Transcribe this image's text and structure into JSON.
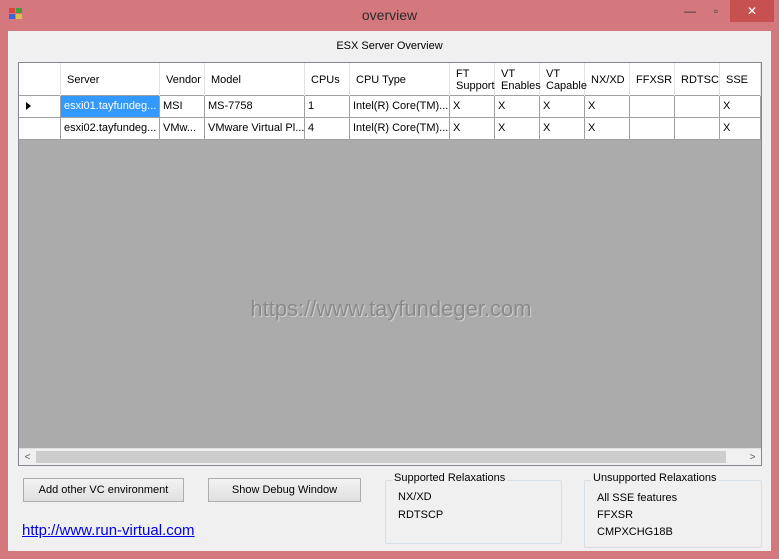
{
  "window": {
    "title": "overview",
    "controls": {
      "minimize": "—",
      "maximize": "▫",
      "close": "✕"
    }
  },
  "heading": "ESX Server Overview",
  "grid": {
    "columns": [
      {
        "key": "server",
        "label": "Server"
      },
      {
        "key": "vendor",
        "label": "Vendor"
      },
      {
        "key": "model",
        "label": "Model"
      },
      {
        "key": "cpus",
        "label": "CPUs"
      },
      {
        "key": "cputype",
        "label": "CPU Type"
      },
      {
        "key": "ft",
        "label": "FT Support"
      },
      {
        "key": "vten",
        "label": "VT Enables"
      },
      {
        "key": "vtcap",
        "label": "VT Capable"
      },
      {
        "key": "nx",
        "label": "NX/XD"
      },
      {
        "key": "ffxsr",
        "label": "FFXSR"
      },
      {
        "key": "rdtsc",
        "label": "RDTSC"
      },
      {
        "key": "sse",
        "label": "SSE"
      }
    ],
    "rows": [
      {
        "server": "esxi01.tayfundeg...",
        "vendor": "MSI",
        "model": "MS-7758",
        "cpus": "1",
        "cputype": "Intel(R) Core(TM)...",
        "ft": "X",
        "vten": "X",
        "vtcap": "X",
        "nx": "X",
        "ffxsr": "",
        "rdtsc": "",
        "sse": "X"
      },
      {
        "server": "esxi02.tayfundeg...",
        "vendor": "VMw...",
        "model": "VMware Virtual Pl...",
        "cpus": "4",
        "cputype": "Intel(R) Core(TM)...",
        "ft": "X",
        "vten": "X",
        "vtcap": "X",
        "nx": "X",
        "ffxsr": "",
        "rdtsc": "",
        "sse": "X"
      }
    ],
    "watermark": "https://www.tayfundeger.com",
    "scroll": {
      "left_arrow": "<",
      "right_arrow": ">"
    }
  },
  "buttons": {
    "add_vc": "Add other VC environment",
    "debug": "Show Debug Window"
  },
  "link": "http://www.run-virtual.com",
  "supported": {
    "title": "Supported Relaxations",
    "items": [
      "NX/XD",
      "RDTSCP"
    ]
  },
  "unsupported": {
    "title": "Unsupported Relaxations",
    "items": [
      "All SSE features",
      "FFXSR",
      "CMPXCHG18B"
    ]
  }
}
